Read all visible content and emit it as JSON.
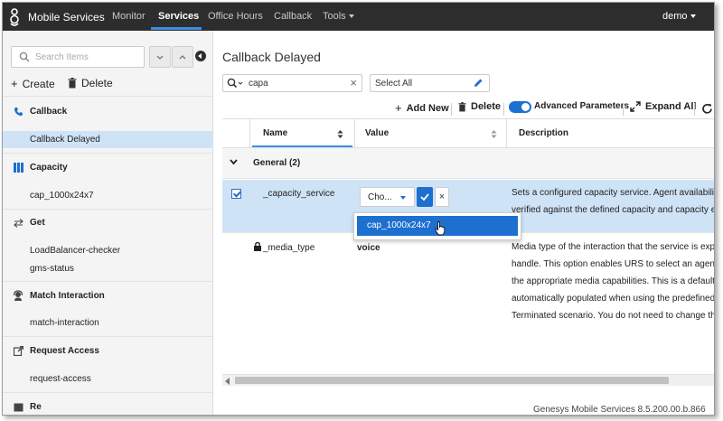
{
  "topnav": {
    "brand": "Mobile Services",
    "items": [
      {
        "label": "Monitor"
      },
      {
        "label": "Services"
      },
      {
        "label": "Office Hours"
      },
      {
        "label": "Callback"
      },
      {
        "label": "Tools"
      }
    ],
    "active": "Services",
    "user": "demo",
    "bg_color": "#2d2d2d",
    "accent_color": "#3c8fe0"
  },
  "sidebar": {
    "search_placeholder": "Search Items",
    "create_label": "Create",
    "delete_label": "Delete",
    "categories": [
      {
        "label": "Callback",
        "icon": "phone-icon",
        "items": [
          "Callback Delayed"
        ]
      },
      {
        "label": "Capacity",
        "icon": "columns-icon",
        "items": [
          "cap_1000x24x7"
        ]
      },
      {
        "label": "Get",
        "icon": "exchange-arrows-icon",
        "items": [
          "LoadBalancer-checker",
          "gms-status"
        ]
      },
      {
        "label": "Match Interaction",
        "icon": "agent-headset-icon",
        "items": [
          "match-interaction"
        ]
      },
      {
        "label": "Request Access",
        "icon": "external-link-icon",
        "items": [
          "request-access"
        ]
      },
      {
        "label": "Re",
        "icon": "calendar-icon",
        "items": []
      }
    ],
    "selected_item": "Callback Delayed",
    "selected_color": "#cfe3f7"
  },
  "main": {
    "title": "Callback Delayed",
    "filter_value": "capa",
    "select_all_label": "Select All",
    "toolbar": {
      "add_new": "Add New",
      "delete": "Delete",
      "advanced_parameters": "Advanced Parameters",
      "advanced_on": true,
      "expand_all": "Expand All"
    },
    "columns": {
      "check": "",
      "name": "Name",
      "value": "Value",
      "description": "Description"
    },
    "group": {
      "title": "General (2)"
    },
    "rows": [
      {
        "name": "_capacity_service",
        "checked": true,
        "value_placeholder": "Cho...",
        "description_lines": [
          "Sets a configured capacity service. Agent availability",
          "verified against the defined capacity and capacity ex"
        ]
      },
      {
        "name": "_media_type",
        "locked": true,
        "value": "voice",
        "description_lines": [
          "Media type of the interaction that the service is expe",
          "handle. This option enables URS to select an agent w",
          "the appropriate media capabilities. This is a default v",
          "automatically populated when using the predefined U",
          "Terminated scenario. You do not need to change this"
        ]
      }
    ],
    "dropdown_option": "cap_1000x24x7",
    "footer": "Genesys Mobile Services 8.5.200.00.b.866"
  }
}
